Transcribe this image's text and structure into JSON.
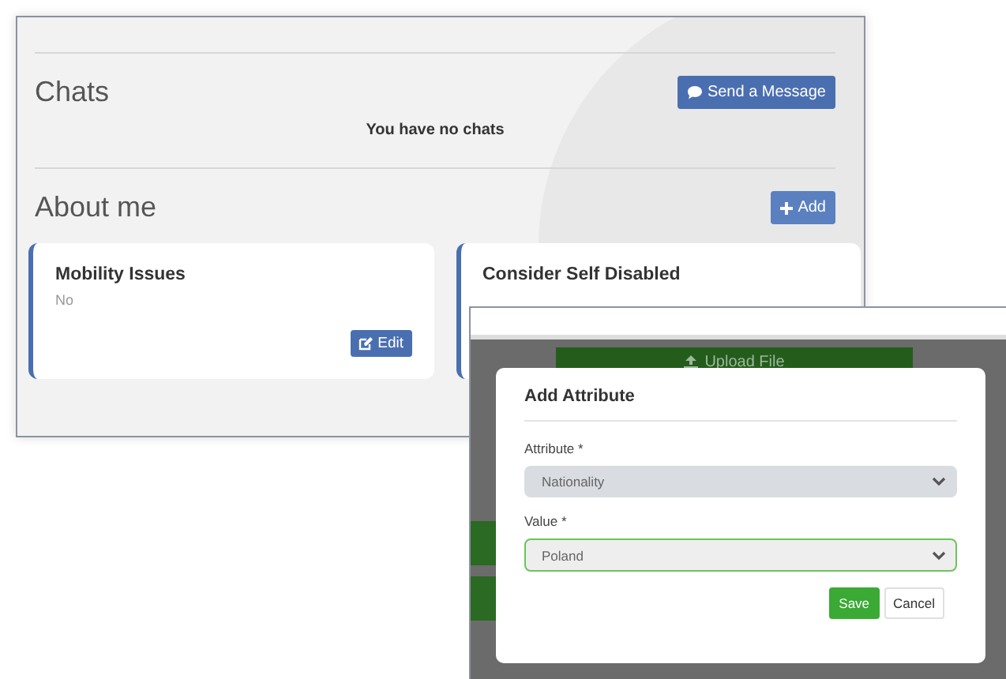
{
  "profile_window": {
    "chats": {
      "title": "Chats",
      "send_button": "Send a Message",
      "empty_text": "You have no chats"
    },
    "about": {
      "title": "About me",
      "add_button": "Add",
      "cards": [
        {
          "title": "Mobility Issues",
          "value": "No",
          "edit_button": "Edit"
        },
        {
          "title": "Consider Self Disabled"
        }
      ]
    }
  },
  "attribute_window": {
    "upload_button": "Upload File",
    "dialog": {
      "title": "Add Attribute",
      "fields": [
        {
          "label": "Attribute *",
          "value": "Nationality",
          "disabled": true
        },
        {
          "label": "Value *",
          "value": "Poland",
          "disabled": false
        }
      ],
      "buttons": [
        {
          "label": "Save",
          "kind": "primary"
        },
        {
          "label": "Cancel",
          "kind": "secondary"
        }
      ]
    }
  }
}
